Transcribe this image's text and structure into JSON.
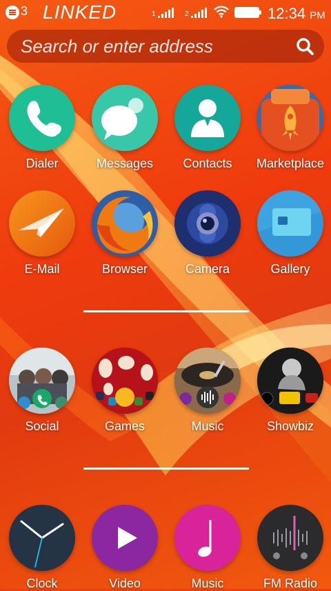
{
  "status_bar": {
    "notification_count": "3",
    "operator": "LINKED",
    "sim1_label": "1",
    "sim2_label": "2",
    "time": "12:34",
    "ampm": "PM"
  },
  "search": {
    "placeholder": "Search or enter address"
  },
  "apps": {
    "row1": [
      {
        "label": "Dialer",
        "icon": "phone-icon",
        "color": "#1fbf95"
      },
      {
        "label": "Messages",
        "icon": "chat-bubbles-icon",
        "color": "#38c7a8"
      },
      {
        "label": "Contacts",
        "icon": "person-icon",
        "color": "#15a89a"
      },
      {
        "label": "Marketplace",
        "icon": "marketplace-rocket-icon",
        "color": "#e4501f"
      }
    ],
    "row2": [
      {
        "label": "E-Mail",
        "icon": "paper-plane-icon",
        "color": "#f07a10"
      },
      {
        "label": "Browser",
        "icon": "firefox-icon",
        "color": "#2e5ea5"
      },
      {
        "label": "Camera",
        "icon": "camera-lens-icon",
        "color": "#1d2f6e"
      },
      {
        "label": "Gallery",
        "icon": "picture-icon",
        "color": "#3da4e0"
      }
    ],
    "collections": [
      {
        "label": "Social",
        "icon": "social-collection-icon"
      },
      {
        "label": "Games",
        "icon": "games-collection-icon"
      },
      {
        "label": "Music",
        "icon": "music-collection-icon"
      },
      {
        "label": "Showbiz",
        "icon": "showbiz-collection-icon"
      }
    ],
    "dock": [
      {
        "label": "Clock",
        "icon": "clock-icon",
        "color": "#253444"
      },
      {
        "label": "Video",
        "icon": "play-icon",
        "color": "#8b27a0"
      },
      {
        "label": "Music",
        "icon": "music-note-icon",
        "color": "#d8239a"
      },
      {
        "label": "FM Radio",
        "icon": "radio-icon",
        "color": "#2b2b2d"
      }
    ]
  }
}
